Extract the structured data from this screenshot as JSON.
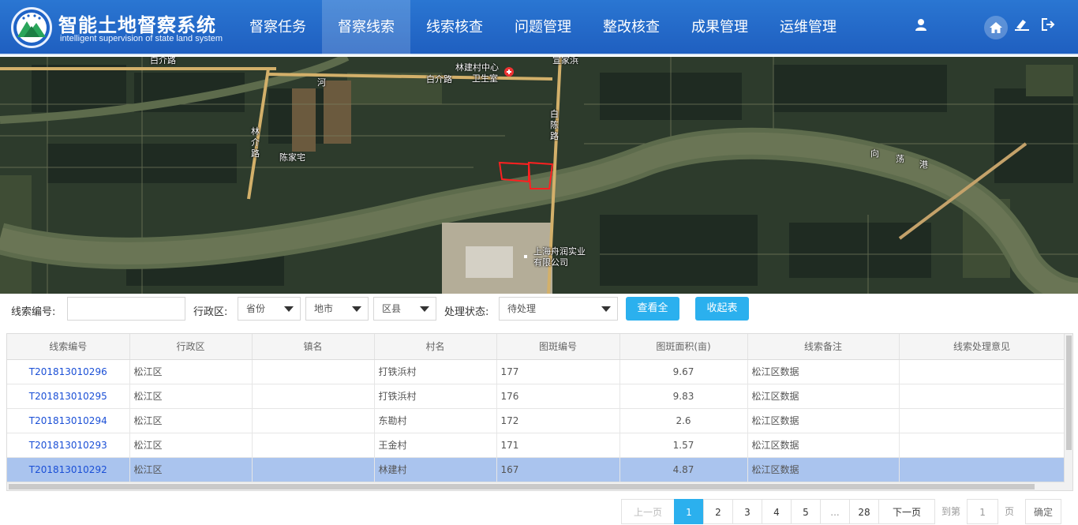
{
  "header": {
    "title": "智能土地督察系统",
    "subtitle": "intelligent supervision of state land system",
    "nav": [
      {
        "label": "督察任务"
      },
      {
        "label": "督察线索"
      },
      {
        "label": "线索核查"
      },
      {
        "label": "问题管理"
      },
      {
        "label": "整改核查"
      },
      {
        "label": "成果管理"
      },
      {
        "label": "运维管理"
      }
    ],
    "active_nav": "督察线索",
    "icons": [
      "user-icon",
      "home-icon",
      "clear-icon",
      "logout-icon"
    ]
  },
  "map": {
    "labels": {
      "bai_jie_lu_1": "白介路",
      "bai_jie_lu_2": "白介路",
      "lin_jian_center": "林建村中心",
      "clinic": "卫生室",
      "lin_jie_lu": "林介路",
      "bai_chen_lu": "白陈路",
      "chen_jia_zhai": "陈家宅",
      "company_1": "上海舟润实业",
      "company_2": "有限公司",
      "river_1": "向",
      "river_2": "荡",
      "river_3": "港",
      "river_left": "河",
      "top_label": "宣家浜"
    }
  },
  "filter": {
    "code_label": "线索编号:",
    "code_value": "",
    "region_label": "行政区:",
    "province": "省份",
    "city": "地市",
    "county": "区县",
    "status_label": "处理状态:",
    "status": "待处理",
    "view_all": "查看全部",
    "collapse": "收起表格"
  },
  "table": {
    "columns": [
      "线索编号",
      "行政区",
      "镇名",
      "村名",
      "图斑编号",
      "图斑面积(亩)",
      "线索备注",
      "线索处理意见"
    ],
    "rows": [
      {
        "code": "T201813010296",
        "region": "松江区",
        "town": "",
        "village": "打铁浜村",
        "spot": "177",
        "area": "9.67",
        "note": "松江区数据",
        "opinion": ""
      },
      {
        "code": "T201813010295",
        "region": "松江区",
        "town": "",
        "village": "打铁浜村",
        "spot": "176",
        "area": "9.83",
        "note": "松江区数据",
        "opinion": ""
      },
      {
        "code": "T201813010294",
        "region": "松江区",
        "town": "",
        "village": "东勘村",
        "spot": "172",
        "area": "2.6",
        "note": "松江区数据",
        "opinion": ""
      },
      {
        "code": "T201813010293",
        "region": "松江区",
        "town": "",
        "village": "王金村",
        "spot": "171",
        "area": "1.57",
        "note": "松江区数据",
        "opinion": ""
      },
      {
        "code": "T201813010292",
        "region": "松江区",
        "town": "",
        "village": "林建村",
        "spot": "167",
        "area": "4.87",
        "note": "松江区数据",
        "opinion": ""
      }
    ],
    "selected_row": 4
  },
  "pager": {
    "prev": "上一页",
    "pages": [
      "1",
      "2",
      "3",
      "4",
      "5",
      "...",
      "28"
    ],
    "current": "1",
    "next": "下一页",
    "goto_label": "到第",
    "goto_value": "1",
    "page_unit": "页",
    "confirm": "确定"
  }
}
